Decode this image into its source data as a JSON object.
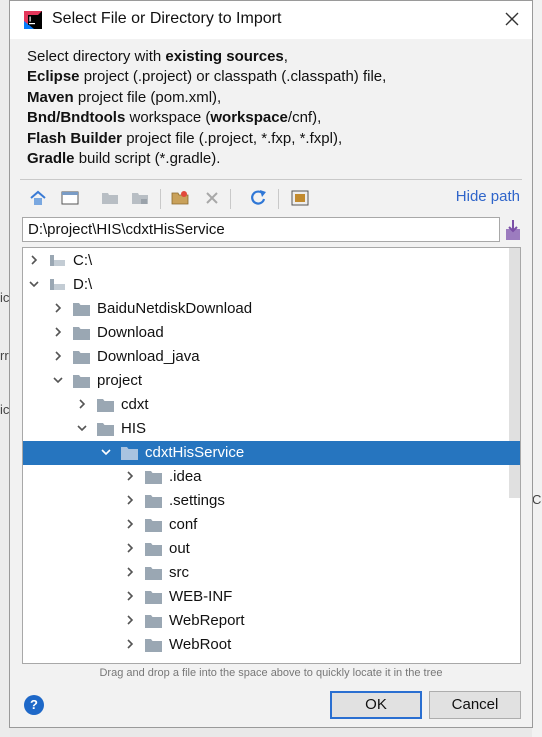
{
  "title": "Select File or Directory to Import",
  "description": [
    [
      {
        "t": "Select directory with ",
        "b": false
      },
      {
        "t": "existing sources",
        "b": true
      },
      {
        "t": ",",
        "b": false
      }
    ],
    [
      {
        "t": "Eclipse",
        "b": true
      },
      {
        "t": " project (.project) or classpath (.classpath) file,",
        "b": false
      }
    ],
    [
      {
        "t": "Maven",
        "b": true
      },
      {
        "t": " project file (pom.xml),",
        "b": false
      }
    ],
    [
      {
        "t": "Bnd/Bndtools",
        "b": true
      },
      {
        "t": " workspace (",
        "b": false
      },
      {
        "t": "workspace",
        "b": true
      },
      {
        "t": "/cnf),",
        "b": false
      }
    ],
    [
      {
        "t": "Flash Builder",
        "b": true
      },
      {
        "t": " project file (.project, *.fxp, *.fxpl),",
        "b": false
      }
    ],
    [
      {
        "t": "Gradle",
        "b": true
      },
      {
        "t": " build script (*.gradle).",
        "b": false
      }
    ]
  ],
  "toolbar": {
    "hide_path_label": "Hide path",
    "buttons": [
      "home-icon",
      "desktop-icon",
      "project-folder-icon",
      "module-folder-icon",
      "new-folder-icon",
      "delete-icon",
      "refresh-icon",
      "show-hidden-icon"
    ]
  },
  "path_value": "D:\\project\\HIS\\cdxtHisService",
  "tree": [
    {
      "label": "C:\\",
      "depth": 0,
      "expanded": false,
      "type": "drive"
    },
    {
      "label": "D:\\",
      "depth": 0,
      "expanded": true,
      "type": "drive"
    },
    {
      "label": "BaiduNetdiskDownload",
      "depth": 1,
      "expanded": false,
      "type": "folder"
    },
    {
      "label": "Download",
      "depth": 1,
      "expanded": false,
      "type": "folder"
    },
    {
      "label": "Download_java",
      "depth": 1,
      "expanded": false,
      "type": "folder"
    },
    {
      "label": "project",
      "depth": 1,
      "expanded": true,
      "type": "folder"
    },
    {
      "label": "cdxt",
      "depth": 2,
      "expanded": false,
      "type": "folder"
    },
    {
      "label": "HIS",
      "depth": 2,
      "expanded": true,
      "type": "folder"
    },
    {
      "label": "cdxtHisService",
      "depth": 3,
      "expanded": true,
      "type": "folder",
      "selected": true
    },
    {
      "label": ".idea",
      "depth": 4,
      "expanded": false,
      "type": "folder"
    },
    {
      "label": ".settings",
      "depth": 4,
      "expanded": false,
      "type": "folder"
    },
    {
      "label": "conf",
      "depth": 4,
      "expanded": false,
      "type": "folder"
    },
    {
      "label": "out",
      "depth": 4,
      "expanded": false,
      "type": "folder"
    },
    {
      "label": "src",
      "depth": 4,
      "expanded": false,
      "type": "folder"
    },
    {
      "label": "WEB-INF",
      "depth": 4,
      "expanded": false,
      "type": "folder"
    },
    {
      "label": "WebReport",
      "depth": 4,
      "expanded": false,
      "type": "folder"
    },
    {
      "label": "WebRoot",
      "depth": 4,
      "expanded": false,
      "type": "folder"
    }
  ],
  "hint": "Drag and drop a file into the space above to quickly locate it in the tree",
  "help_label": "?",
  "ok_label": "OK",
  "cancel_label": "Cancel",
  "background_fragments": [
    "ic",
    "rr",
    "ic",
    "Co"
  ],
  "colors": {
    "selection": "#2675bf",
    "link": "#2f65ca",
    "folder": "#9aa7b3",
    "ok_border": "#2a6fd1"
  }
}
